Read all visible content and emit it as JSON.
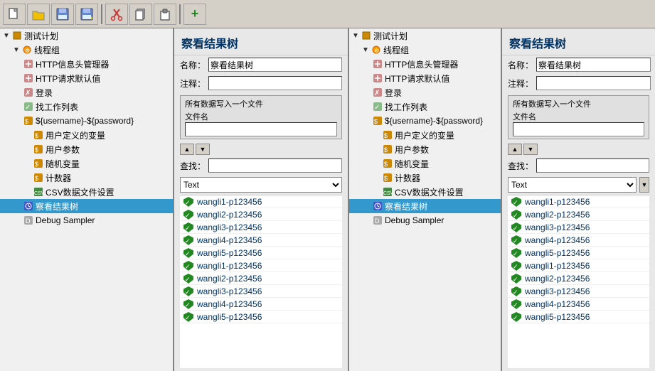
{
  "toolbar": {
    "buttons": [
      {
        "id": "new",
        "icon": "📄",
        "label": "New"
      },
      {
        "id": "open",
        "icon": "📂",
        "label": "Open"
      },
      {
        "id": "save",
        "icon": "💾",
        "label": "Save"
      },
      {
        "id": "saveas",
        "icon": "💾",
        "label": "Save As"
      },
      {
        "id": "cut",
        "icon": "✂",
        "label": "Cut"
      },
      {
        "id": "copy",
        "icon": "📋",
        "label": "Copy"
      },
      {
        "id": "paste",
        "icon": "📋",
        "label": "Paste"
      },
      {
        "id": "add",
        "icon": "+",
        "label": "Add"
      }
    ]
  },
  "left_tree": {
    "items": [
      {
        "id": "plan",
        "label": "测试计划",
        "level": 0,
        "icon": "triangle",
        "type": "plan"
      },
      {
        "id": "threadgroup",
        "label": "线程组",
        "level": 1,
        "icon": "gear",
        "type": "thread"
      },
      {
        "id": "http-header",
        "label": "HTTP信息头管理器",
        "level": 2,
        "icon": "x",
        "type": "http"
      },
      {
        "id": "http-default",
        "label": "HTTP请求默认值",
        "level": 2,
        "icon": "x",
        "type": "http"
      },
      {
        "id": "login",
        "label": "登录",
        "level": 2,
        "icon": "x",
        "type": "login"
      },
      {
        "id": "worklist",
        "label": "找工作列表",
        "level": 2,
        "icon": "check",
        "type": "check"
      },
      {
        "id": "userpwd",
        "label": "${username}-${password}",
        "level": 2,
        "icon": "gear",
        "type": "var"
      },
      {
        "id": "uservars",
        "label": "用户定义的变量",
        "level": 3,
        "icon": "pencil",
        "type": "var"
      },
      {
        "id": "userparams",
        "label": "用户参数",
        "level": 3,
        "icon": "user",
        "type": "var"
      },
      {
        "id": "random",
        "label": "随机变量",
        "level": 3,
        "icon": "rand",
        "type": "var"
      },
      {
        "id": "counter",
        "label": "计数器",
        "level": 3,
        "icon": "count",
        "type": "var"
      },
      {
        "id": "csv",
        "label": "CSV数据文件设置",
        "level": 3,
        "icon": "csv",
        "type": "csv"
      },
      {
        "id": "watch",
        "label": "察看结果树",
        "level": 2,
        "icon": "watch",
        "type": "watch",
        "selected": true
      },
      {
        "id": "debug",
        "label": "Debug Sampler",
        "level": 2,
        "icon": "debug",
        "type": "debug"
      }
    ]
  },
  "center_tree": {
    "items": [
      {
        "id": "plan2",
        "label": "测试计划",
        "level": 0,
        "icon": "triangle",
        "type": "plan"
      },
      {
        "id": "threadgroup2",
        "label": "线程组",
        "level": 1,
        "icon": "gear",
        "type": "thread"
      },
      {
        "id": "http-header2",
        "label": "HTTP信息头管理器",
        "level": 2,
        "icon": "x",
        "type": "http"
      },
      {
        "id": "http-default2",
        "label": "HTTP请求默认值",
        "level": 2,
        "icon": "x",
        "type": "http"
      },
      {
        "id": "login2",
        "label": "登录",
        "level": 2,
        "icon": "x",
        "type": "login"
      },
      {
        "id": "worklist2",
        "label": "找工作列表",
        "level": 2,
        "icon": "check",
        "type": "check"
      },
      {
        "id": "userpwd2",
        "label": "${username}-${password}",
        "level": 2,
        "icon": "gear",
        "type": "var"
      },
      {
        "id": "uservars2",
        "label": "用户定义的变量",
        "level": 3,
        "icon": "pencil",
        "type": "var"
      },
      {
        "id": "userparams2",
        "label": "用户参数",
        "level": 3,
        "icon": "user",
        "type": "var"
      },
      {
        "id": "random2",
        "label": "随机变量",
        "level": 3,
        "icon": "rand",
        "type": "var"
      },
      {
        "id": "counter2",
        "label": "计数器",
        "level": 3,
        "icon": "count",
        "type": "var"
      },
      {
        "id": "csv2",
        "label": "CSV数据文件设置",
        "level": 3,
        "icon": "csv",
        "type": "csv"
      },
      {
        "id": "watch2",
        "label": "察看结果树",
        "level": 2,
        "icon": "watch",
        "type": "watch",
        "selected": true
      },
      {
        "id": "debug2",
        "label": "Debug Sampler",
        "level": 2,
        "icon": "debug",
        "type": "debug"
      }
    ]
  },
  "results_panel_left": {
    "title": "察看结果树",
    "name_label": "名称：",
    "name_value": "察看结果树",
    "comment_label": "注释：",
    "comment_value": "",
    "section_title": "所有数据写入一个文件",
    "filename_label": "文件名",
    "filename_value": "",
    "search_label": "查找：",
    "search_value": "",
    "text_dropdown": "Text",
    "results": [
      "wangli1-p123456",
      "wangli2-p123456",
      "wangli3-p123456",
      "wangli4-p123456",
      "wangli5-p123456",
      "wangli1-p123456",
      "wangli2-p123456",
      "wangli3-p123456",
      "wangli4-p123456",
      "wangli5-p123456"
    ]
  },
  "results_panel_right": {
    "title": "察看结果树",
    "name_label": "名称：",
    "name_value": "察看结果树",
    "comment_label": "注释：",
    "comment_value": "",
    "section_title": "所有数据写入一个文件",
    "filename_label": "文件名",
    "filename_value": "",
    "search_label": "查找：",
    "search_value": "",
    "text_dropdown": "Text",
    "results": [
      "wangli1-p123456",
      "wangli2-p123456",
      "wangli3-p123456",
      "wangli4-p123456",
      "wangli5-p123456",
      "wangli1-p123456",
      "wangli2-p123456",
      "wangli3-p123456",
      "wangli4-p123456",
      "wangli5-p123456"
    ]
  }
}
